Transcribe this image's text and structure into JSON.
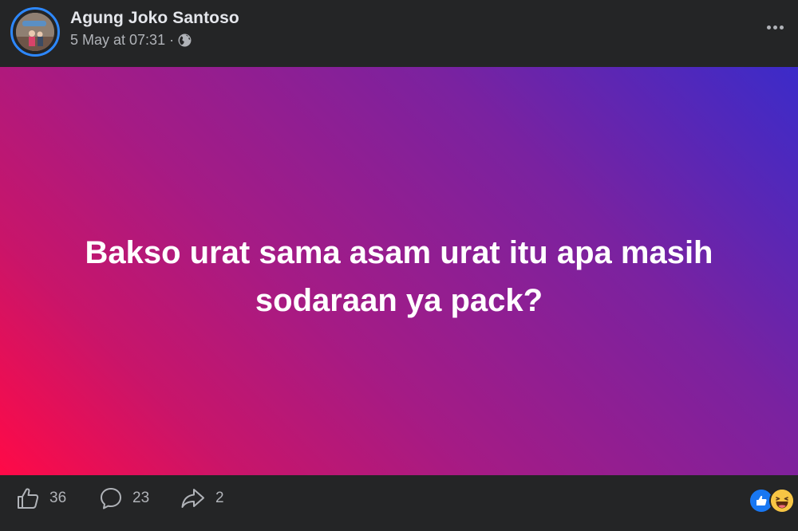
{
  "post": {
    "author": "Agung Joko Santoso",
    "timestamp": "5 May at 07:31",
    "separator": "·",
    "privacy_icon": "globe-icon",
    "text": "Bakso urat sama asam urat itu apa masih sodaraan ya pack?",
    "background_gradient": [
      "#3b2bc9",
      "#7a22a0",
      "#a51b85",
      "#c8156a",
      "#ff0a47"
    ]
  },
  "actions": {
    "like_count": "36",
    "comment_count": "23",
    "share_count": "2"
  },
  "reactions": [
    "like-reaction-icon",
    "haha-reaction-icon"
  ],
  "colors": {
    "background": "#242526",
    "primary_text": "#e4e6eb",
    "secondary_text": "#b0b3b8",
    "accent": "#2d88ff"
  }
}
